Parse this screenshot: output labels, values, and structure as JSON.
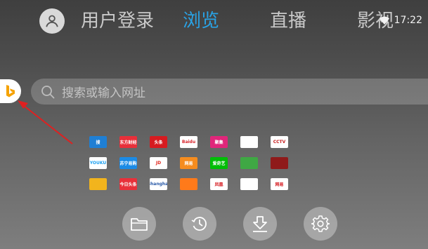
{
  "header": {
    "tabs": [
      {
        "label": "用户登录",
        "active": false
      },
      {
        "label": "浏览",
        "active": true
      },
      {
        "label": "直播",
        "active": false
      },
      {
        "label": "影视",
        "active": false
      }
    ],
    "time": "17:22",
    "icons": {
      "avatar": "user-icon",
      "wifi": "wifi-icon"
    }
  },
  "search": {
    "placeholder": "搜索或输入网址",
    "engine_logo": "bing-logo",
    "icon": "search-icon"
  },
  "tiles": [
    {
      "label": "搜",
      "bg": "#1f7fd4",
      "fg": "#ffffff"
    },
    {
      "label": "东方财经",
      "bg": "#e8303a",
      "fg": "#ffffff"
    },
    {
      "label": "头条",
      "bg": "#d61b20",
      "fg": "#ffffff"
    },
    {
      "label": "Baidu",
      "bg": "#ffffff",
      "fg": "#d8232a"
    },
    {
      "label": "聚集",
      "bg": "#e0267a",
      "fg": "#ffffff"
    },
    {
      "label": "",
      "bg": "#ffffff",
      "fg": "#5b3cc4"
    },
    {
      "label": "CCTV",
      "bg": "#ffffff",
      "fg": "#c81e1e"
    },
    {
      "label": "YOUKU",
      "bg": "#ffffff",
      "fg": "#1a9ff0"
    },
    {
      "label": "苏宁易购",
      "bg": "#1b8be6",
      "fg": "#ffffff"
    },
    {
      "label": "JD",
      "bg": "#ffffff",
      "fg": "#e1251b"
    },
    {
      "label": "网易",
      "bg": "#f58c1f",
      "fg": "#ffffff"
    },
    {
      "label": "爱奇艺",
      "bg": "#00be06",
      "fg": "#ffffff"
    },
    {
      "label": "",
      "bg": "#3fa844",
      "fg": "#ffffff"
    },
    {
      "label": "",
      "bg": "#8f1a1a",
      "fg": "#ffffff"
    },
    {
      "label": "",
      "bg": "#f2b41d",
      "fg": "#c21d1d"
    },
    {
      "label": "今日头条",
      "bg": "#e8303a",
      "fg": "#ffffff"
    },
    {
      "label": "Shanghai",
      "bg": "#ffffff",
      "fg": "#2a5aa8"
    },
    {
      "label": "",
      "bg": "#ff7a1a",
      "fg": "#ffffff"
    },
    {
      "label": "凤凰",
      "bg": "#ffffff",
      "fg": "#d61b20"
    },
    {
      "label": "",
      "bg": "#ffffff",
      "fg": "#3a9a3a"
    },
    {
      "label": "网易",
      "bg": "#ffffff",
      "fg": "#d61b20"
    }
  ],
  "bottom_buttons": [
    {
      "name": "bookmarks-button",
      "icon": "folder-icon"
    },
    {
      "name": "history-button",
      "icon": "history-icon"
    },
    {
      "name": "downloads-button",
      "icon": "download-icon"
    },
    {
      "name": "settings-button",
      "icon": "gear-icon"
    }
  ]
}
